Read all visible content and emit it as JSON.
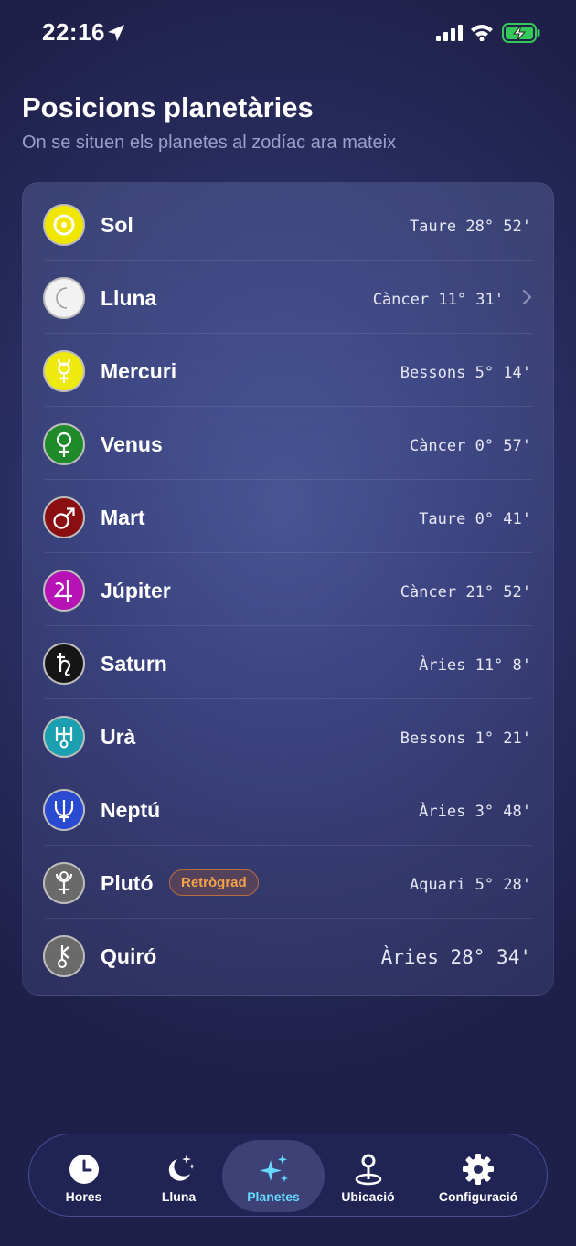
{
  "status_bar": {
    "time": "22:16"
  },
  "header": {
    "title": "Posicions planetàries",
    "subtitle": "On se situen els planetes al zodíac ara mateix"
  },
  "planets": [
    {
      "name": "Sol",
      "position": "Taure 28° 52'",
      "icon": "sun-symbol-icon",
      "color": "#f0e600"
    },
    {
      "name": "Lluna",
      "position": "Càncer 11° 31'",
      "icon": "moon-symbol-icon",
      "color": "#f2f2f2"
    },
    {
      "name": "Mercuri",
      "position": "Bessons 5° 14'",
      "icon": "mercury-symbol-icon",
      "color": "#eeea10"
    },
    {
      "name": "Venus",
      "position": "Càncer 0° 57'",
      "icon": "venus-symbol-icon",
      "color": "#1f8a2a"
    },
    {
      "name": "Mart",
      "position": "Taure 0° 41'",
      "icon": "mars-symbol-icon",
      "color": "#8a0f12"
    },
    {
      "name": "Júpiter",
      "position": "Càncer 21° 52'",
      "icon": "jupiter-symbol-icon",
      "color": "#b612b6"
    },
    {
      "name": "Saturn",
      "position": "Àries 11° 8'",
      "icon": "saturn-symbol-icon",
      "color": "#1a1a1a"
    },
    {
      "name": "Urà",
      "position": "Bessons 1° 21'",
      "icon": "uranus-symbol-icon",
      "color": "#1aa0b0"
    },
    {
      "name": "Neptú",
      "position": "Àries 3° 48'",
      "icon": "neptune-symbol-icon",
      "color": "#2a4ad0"
    },
    {
      "name": "Plutó",
      "position": "Aquari 5° 28'",
      "icon": "pluto-symbol-icon",
      "color": "#6a6a6a",
      "badge": "Retrògrad"
    },
    {
      "name": "Quiró",
      "position": "Àries 28° 34'",
      "icon": "chiron-symbol-icon",
      "color": "#6a6a6a"
    }
  ],
  "tabs": [
    {
      "label": "Hores",
      "icon": "clock-icon"
    },
    {
      "label": "Lluna",
      "icon": "moon-stars-icon"
    },
    {
      "label": "Planetes",
      "icon": "sparkles-icon",
      "active": true
    },
    {
      "label": "Ubicació",
      "icon": "location-pin-icon"
    },
    {
      "label": "Configuració",
      "icon": "gear-icon"
    }
  ],
  "colors": {
    "accent": "#66d9ff",
    "badge": "#f6a24a",
    "battery": "#34c759"
  }
}
